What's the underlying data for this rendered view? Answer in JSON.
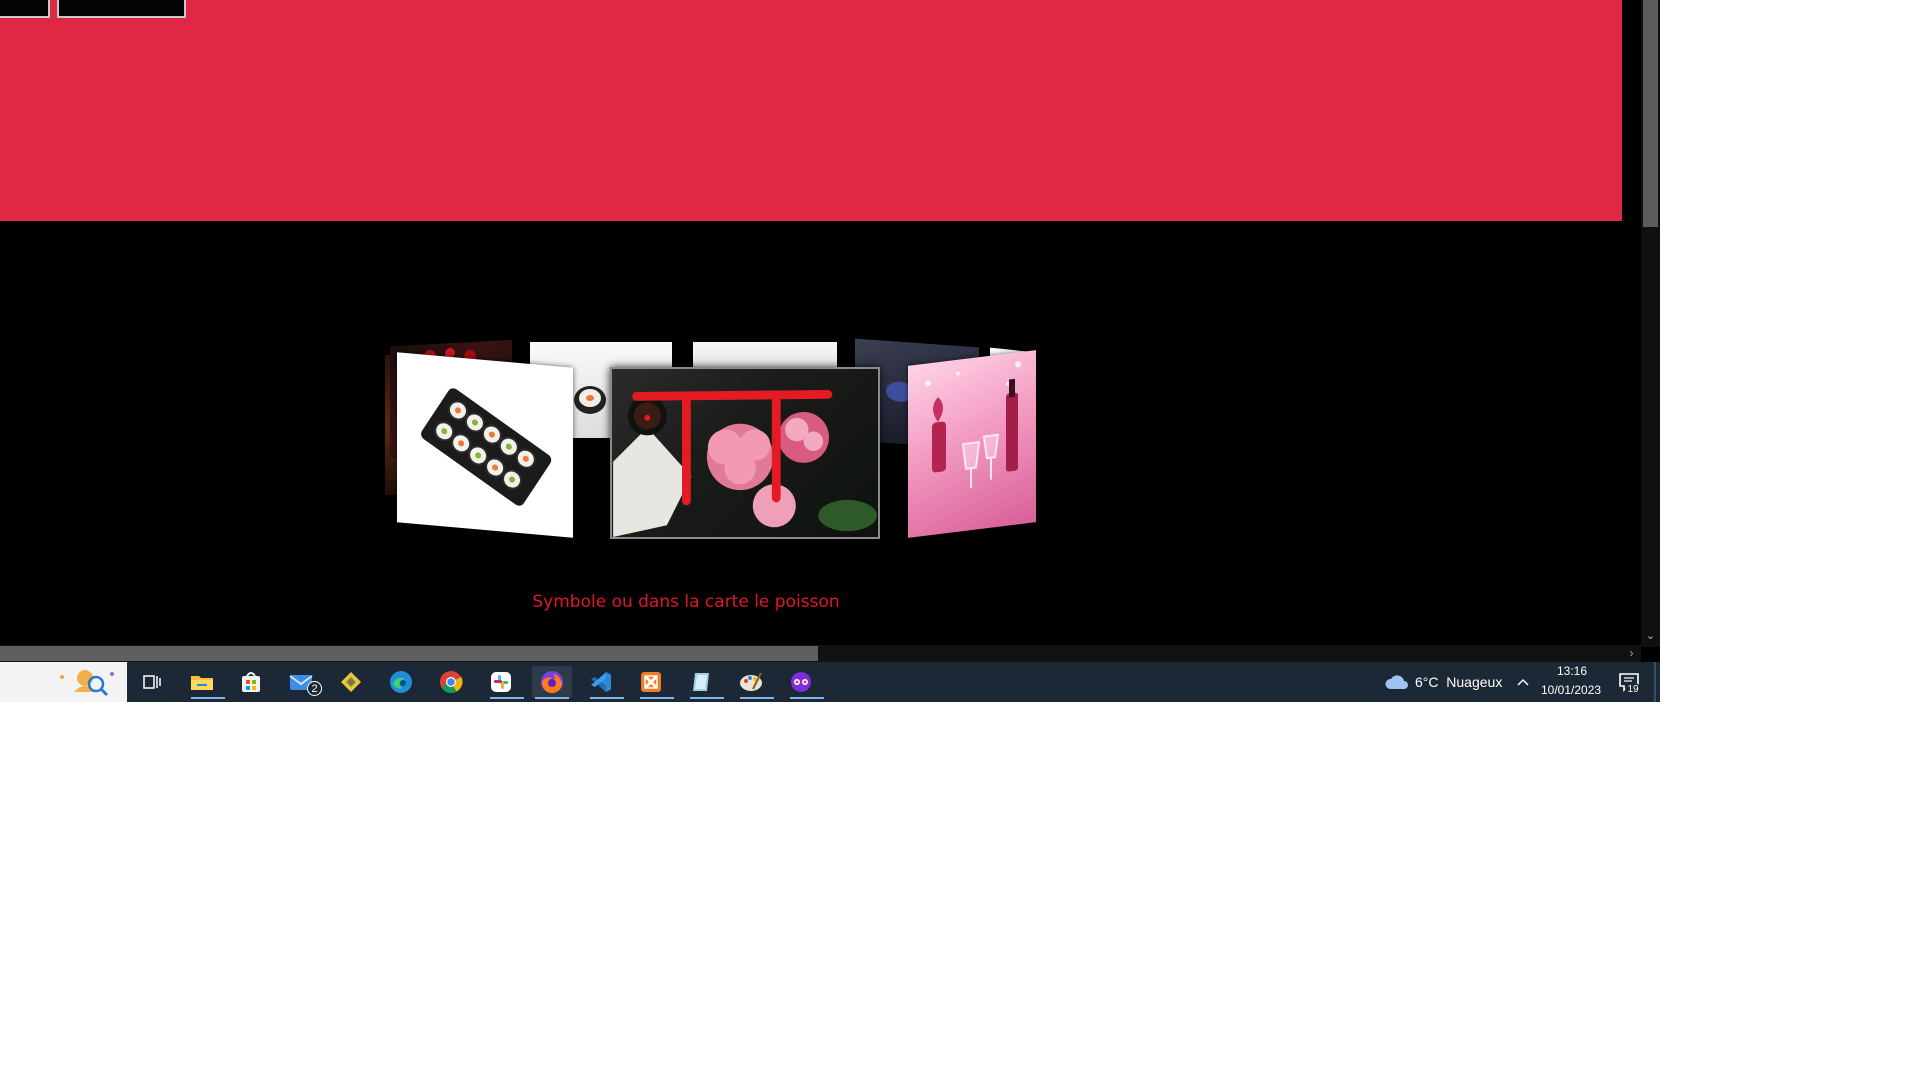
{
  "page": {
    "caption": "Symbole ou dans la carte le poisson",
    "accent_color": "#df2843",
    "caption_color": "#e0162c"
  },
  "carousel": {
    "cards": [
      {
        "name": "sushi",
        "description_icon": "sushi-image"
      },
      {
        "name": "flowers",
        "description_icon": "peony-flowers-image"
      },
      {
        "name": "wine",
        "description_icon": "pink-wine-image"
      }
    ]
  },
  "taskbar": {
    "search_icon": "search-icon",
    "apps": [
      {
        "name": "task-view",
        "icon": "task-view-icon"
      },
      {
        "name": "file-explorer",
        "icon": "folder-icon"
      },
      {
        "name": "microsoft-store",
        "icon": "store-icon"
      },
      {
        "name": "mail",
        "icon": "mail-icon",
        "badge": "2"
      },
      {
        "name": "git-tool",
        "icon": "diamond-icon"
      },
      {
        "name": "edge",
        "icon": "edge-icon"
      },
      {
        "name": "chrome",
        "icon": "chrome-icon"
      },
      {
        "name": "slack",
        "icon": "slack-icon"
      },
      {
        "name": "firefox",
        "icon": "firefox-icon"
      },
      {
        "name": "vscode",
        "icon": "vscode-icon"
      },
      {
        "name": "xampp",
        "icon": "xampp-icon"
      },
      {
        "name": "notepad",
        "icon": "notepad-icon"
      },
      {
        "name": "paint",
        "icon": "paint-palette-icon"
      },
      {
        "name": "app-purple",
        "icon": "mask-icon"
      }
    ],
    "weather": {
      "temp": "6°C",
      "condition": "Nuageux",
      "icon": "cloud-icon"
    },
    "clock": {
      "time": "13:16",
      "date": "10/01/2023"
    },
    "notifications": {
      "count": "19",
      "icon": "notification-icon"
    }
  }
}
